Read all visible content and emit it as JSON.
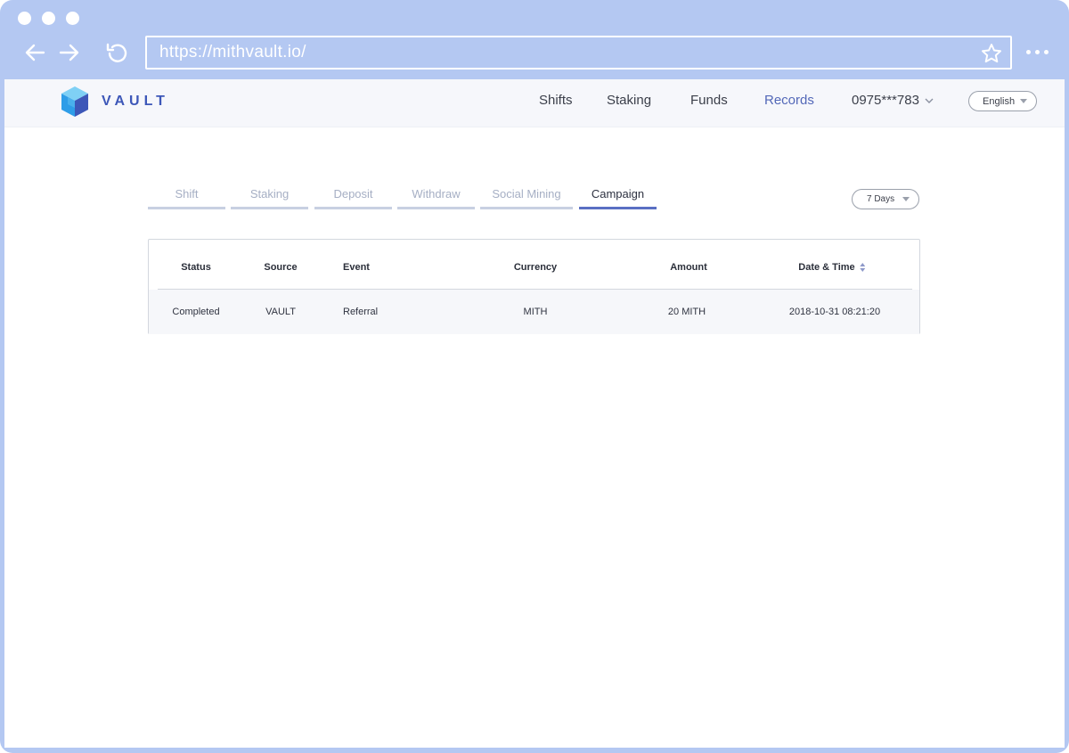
{
  "browser": {
    "url": "https://mithvault.io/"
  },
  "topnav": {
    "logo_text": "VAULT",
    "items": [
      {
        "label": "Shifts"
      },
      {
        "label": "Staking"
      },
      {
        "label": "Funds"
      },
      {
        "label": "Records",
        "active": true
      }
    ],
    "account": "0975***783",
    "language": "English"
  },
  "tabs": [
    {
      "label": "Shift"
    },
    {
      "label": "Staking"
    },
    {
      "label": "Deposit"
    },
    {
      "label": "Withdraw"
    },
    {
      "label": "Social Mining"
    },
    {
      "label": "Campaign",
      "active": true
    }
  ],
  "filter": {
    "range": "7 Days"
  },
  "table": {
    "headers": [
      "Status",
      "Source",
      "Event",
      "Currency",
      "Amount",
      "Date & Time"
    ],
    "rows": [
      [
        "Completed",
        "VAULT",
        "Referral",
        "MITH",
        "20 MITH",
        "2018-10-31 08:21:20"
      ]
    ]
  },
  "colors": {
    "frame": "#b4c8f2",
    "accent": "#5a6fc3",
    "logo": "#3d57b8"
  }
}
